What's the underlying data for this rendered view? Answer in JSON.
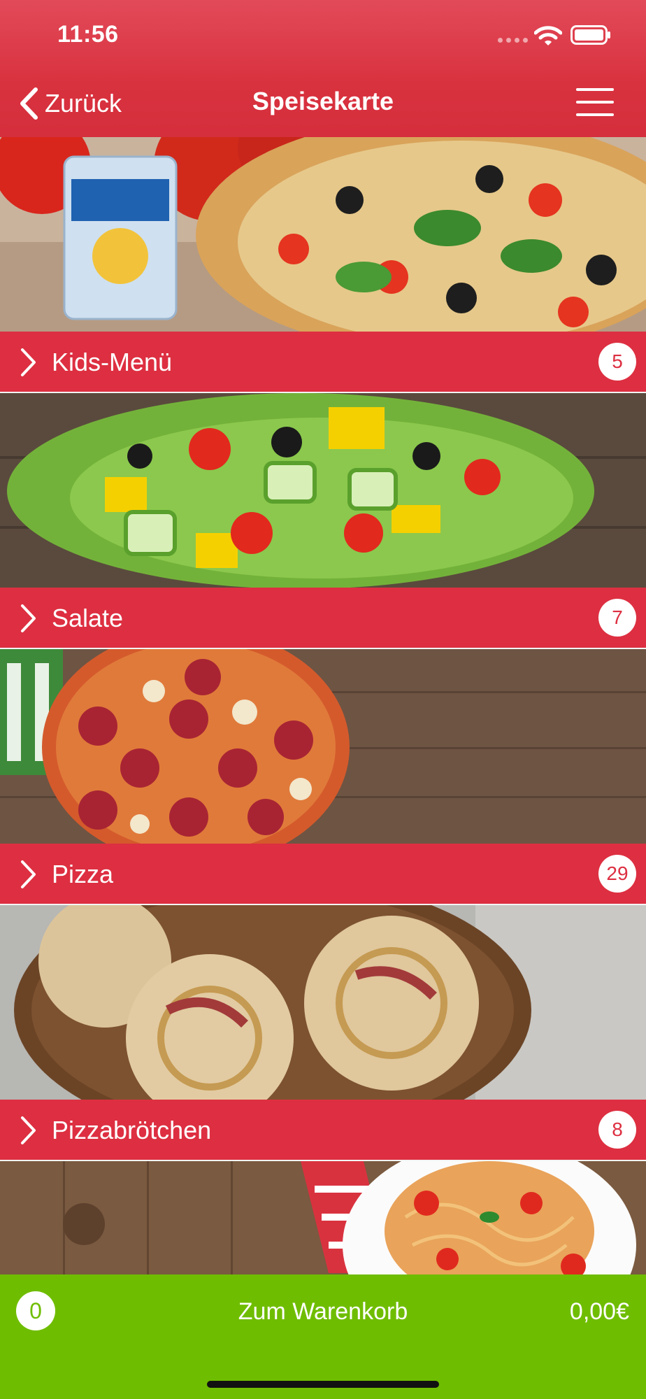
{
  "status_bar": {
    "time": "11:56"
  },
  "nav": {
    "back_label": "Zurück",
    "title": "Speisekarte"
  },
  "categories": [
    {
      "name": "Kids-Menü",
      "count": "5",
      "image": "pizza-with-capri-sonne"
    },
    {
      "name": "Salate",
      "count": "7",
      "image": "mixed-salad"
    },
    {
      "name": "Pizza",
      "count": "29",
      "image": "salami-pizza"
    },
    {
      "name": "Pizzabrötchen",
      "count": "8",
      "image": "pizza-rolls"
    },
    {
      "name": "",
      "count": "",
      "image": "spaghetti"
    }
  ],
  "cart": {
    "count": "0",
    "label": "Zum Warenkorb",
    "total": "0,00€"
  },
  "colors": {
    "header": "#d9323f",
    "category_bar": "#dd2f41",
    "cart_bar": "#6fbd00"
  }
}
